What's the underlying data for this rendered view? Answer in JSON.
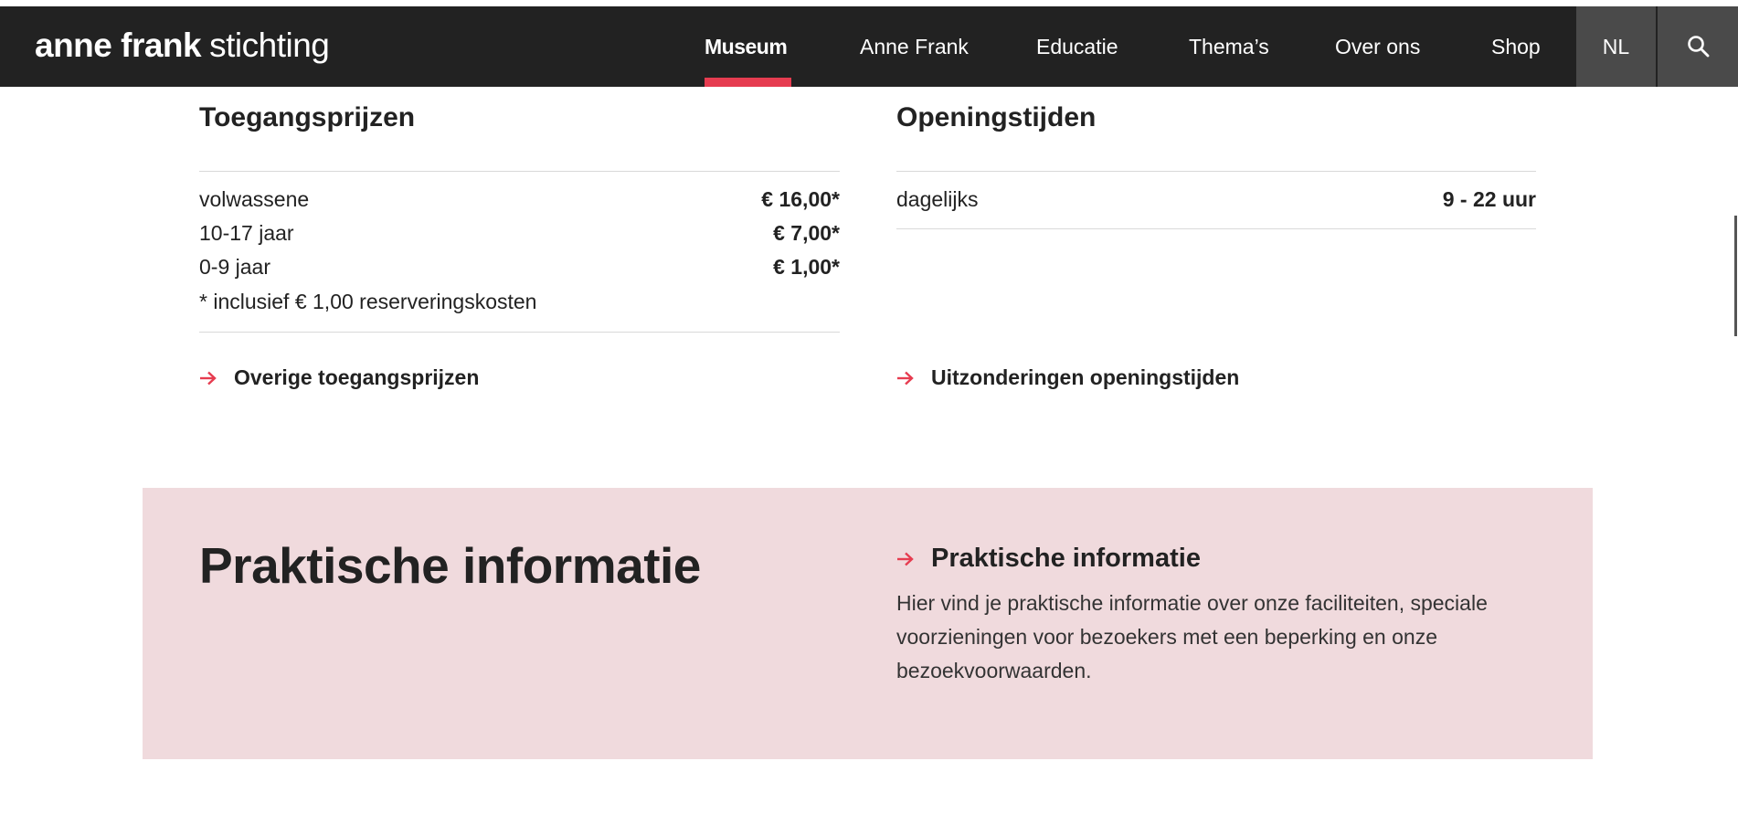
{
  "header": {
    "logo_bold": "anne frank",
    "logo_light": "stichting",
    "nav": [
      {
        "label": "Museum"
      },
      {
        "label": "Anne Frank"
      },
      {
        "label": "Educatie"
      },
      {
        "label": "Thema’s"
      },
      {
        "label": "Over ons"
      },
      {
        "label": "Shop"
      }
    ],
    "active_nav": "Museum",
    "language": "NL",
    "search_icon": "search-icon"
  },
  "prices": {
    "title": "Toegangsprijzen",
    "rows": [
      {
        "label": "volwassene",
        "value": "€ 16,00*"
      },
      {
        "label": "10-17 jaar",
        "value": "€ 7,00*"
      },
      {
        "label": "0-9 jaar",
        "value": "€ 1,00*"
      }
    ],
    "footnote": "* inclusief € 1,00 reserveringskosten",
    "link_label": "Overige toegangsprijzen"
  },
  "hours": {
    "title": "Openingstijden",
    "rows": [
      {
        "label": "dagelijks",
        "value": "9 - 22 uur"
      }
    ],
    "link_label": "Uitzonderingen openingstijden"
  },
  "practical": {
    "heading": "Praktische informatie",
    "link_label": "Praktische informatie",
    "description": "Hier vind je praktische informatie over onze faciliteiten, speciale voorzieningen voor bezoekers met een beperking en onze bezoekvoorwaarden."
  },
  "colors": {
    "nav_background": "#222222",
    "accent": "#e63c50",
    "panel_background": "#f0dadd",
    "nav_button_background": "#4a4a4a"
  },
  "icons": {
    "link_arrow": "arrow-right-icon"
  }
}
